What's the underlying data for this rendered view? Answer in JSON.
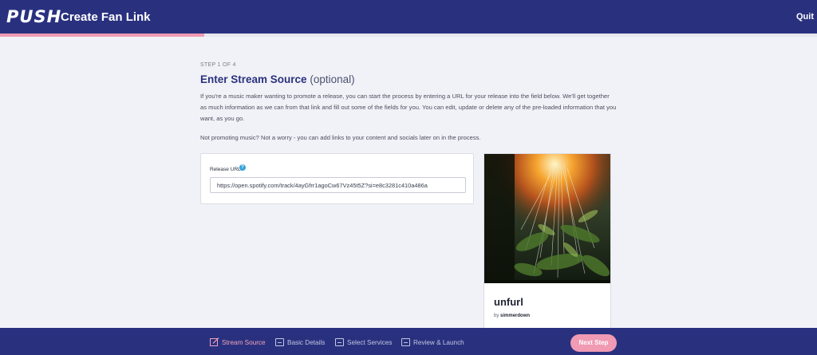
{
  "header": {
    "logo": "PUSH",
    "title": "Create Fan Link",
    "quit_label": "Quit",
    "progress_fraction": 0.25
  },
  "main": {
    "step_label": "STEP 1 OF 4",
    "heading_bold": "Enter Stream Source",
    "heading_optional": "(optional)",
    "paragraph_1": "If you're a music maker wanting to promote a release, you can start the process by entering a URL for your release into the field below. We'll get together as much information as we can from that link and fill out some of the fields for you. You can edit, update or delete any of the pre-loaded information that you want, as you go.",
    "paragraph_2": "Not promoting music? Not a worry - you can add links to your content and socials later on in the process.",
    "form": {
      "release_url_label": "Release URL",
      "help_icon": "?",
      "release_url_value": "https://open.spotify.com/track/4ayGfrr1agoCw67Vz45t5Z?si=e8c3281c410a486a"
    }
  },
  "release": {
    "title": "unfurl",
    "by_prefix": "by",
    "artist": "simmerdown"
  },
  "footer": {
    "steps": [
      {
        "label": "Stream Source",
        "icon": "edit-icon",
        "active": true
      },
      {
        "label": "Basic Details",
        "icon": "card-icon",
        "active": false
      },
      {
        "label": "Select Services",
        "icon": "card-icon",
        "active": false
      },
      {
        "label": "Review & Launch",
        "icon": "card-icon",
        "active": false
      }
    ],
    "next_label": "Next Step"
  },
  "colors": {
    "brand_navy": "#29317f",
    "accent_pink": "#f09ab3",
    "background": "#f1f2f7"
  }
}
